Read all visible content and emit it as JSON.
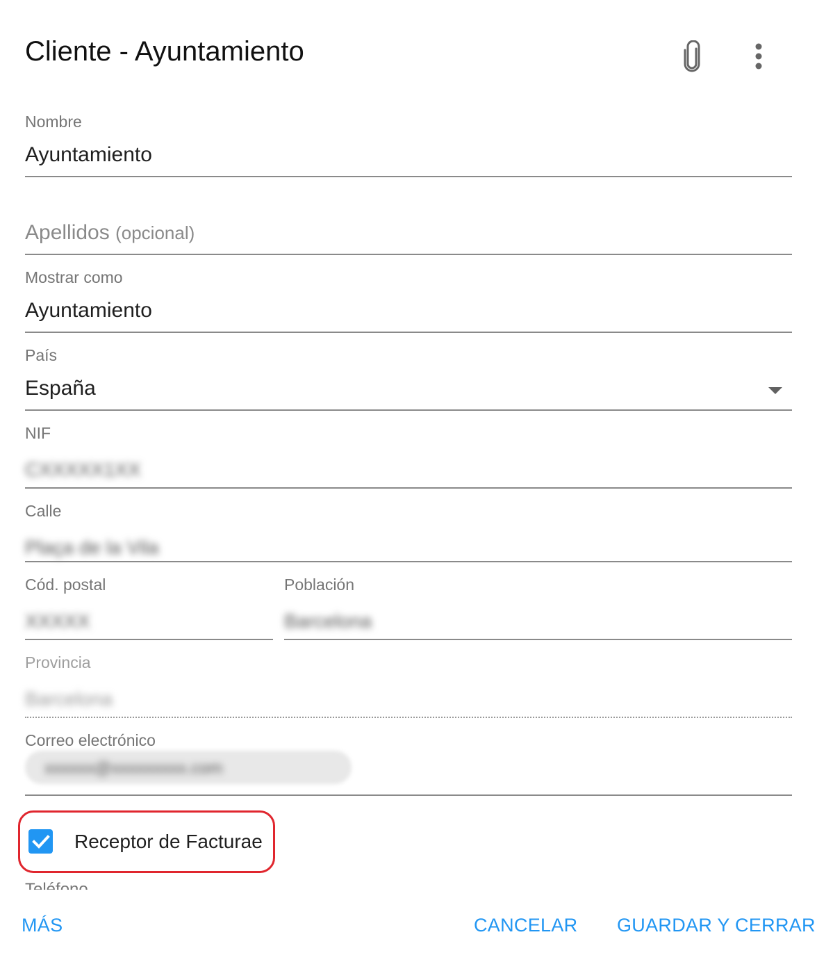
{
  "header": {
    "title": "Cliente - Ayuntamiento",
    "attach_icon": "paperclip-icon",
    "more_icon": "more-vert-icon"
  },
  "form": {
    "nombre": {
      "label": "Nombre",
      "value": "Ayuntamiento"
    },
    "apellidos": {
      "label": "Apellidos",
      "hint": "(opcional)"
    },
    "mostrar_como": {
      "label": "Mostrar como",
      "value": "Ayuntamiento"
    },
    "pais": {
      "label": "País",
      "value": "España"
    },
    "nif": {
      "label": "NIF",
      "value": "CXXXXX1XX"
    },
    "calle": {
      "label": "Calle",
      "value": "Plaça de la Vila"
    },
    "cod_postal": {
      "label": "Cód. postal",
      "value": "XXXXX"
    },
    "poblacion": {
      "label": "Población",
      "value": "Barcelona"
    },
    "provincia": {
      "label": "Provincia",
      "value": "Barcelona"
    },
    "correo": {
      "label": "Correo electrónico",
      "value": "xxxxxx@xxxxxxxxx.com"
    },
    "receptor_facturae": {
      "label": "Receptor de Facturae",
      "checked": true
    },
    "telefono_partial": {
      "label": "Teléfono"
    }
  },
  "footer": {
    "mas": "MÁS",
    "cancelar": "CANCELAR",
    "guardar": "GUARDAR Y CERRAR"
  },
  "colors": {
    "accent": "#2196f3",
    "highlight": "#e0262e"
  }
}
